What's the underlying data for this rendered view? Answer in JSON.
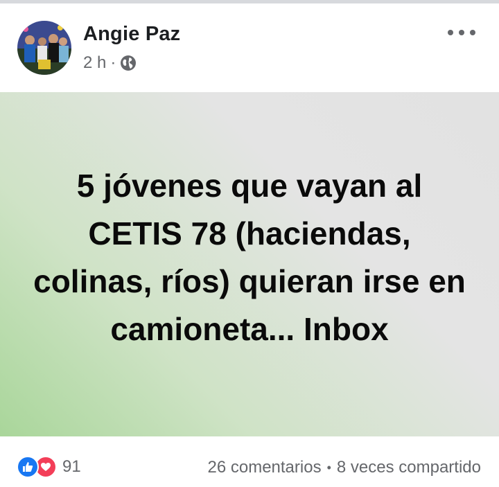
{
  "post": {
    "author": "Angie Paz",
    "time": "2 h",
    "separator": "·",
    "privacy_icon": "globe-icon",
    "text": "5 jóvenes que vayan al CETIS 78 (haciendas, colinas, ríos) quieran irse en camioneta... Inbox"
  },
  "footer": {
    "reaction_icons": [
      "like-icon",
      "love-icon"
    ],
    "reaction_count": "91",
    "comments": "26 comentarios",
    "separator": "•",
    "shares": "8 veces compartido"
  },
  "colors": {
    "like": "#1877f2",
    "love": "#f33e58",
    "gradient_start": "#a9d69a",
    "gradient_end": "#e2e2e2"
  }
}
